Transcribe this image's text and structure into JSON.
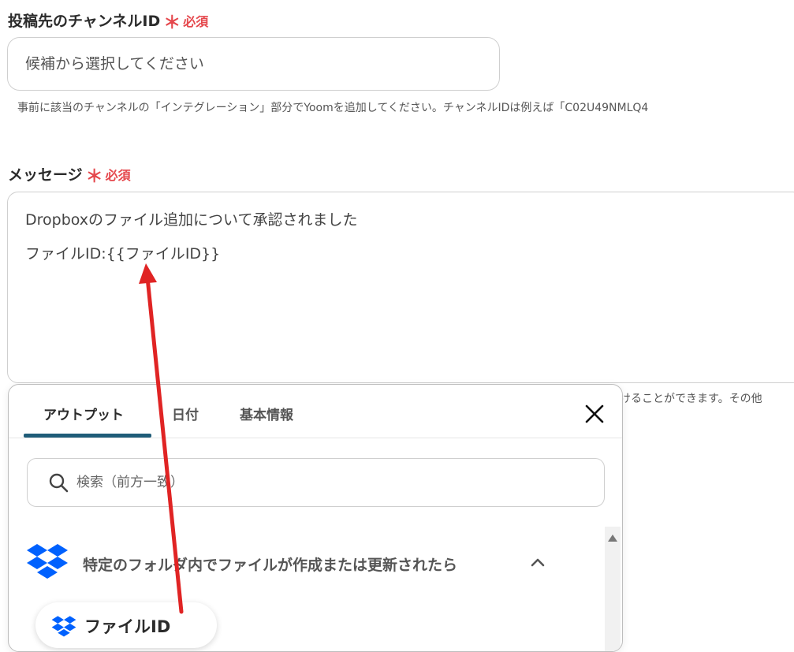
{
  "channel_field": {
    "label": "投稿先のチャンネルID",
    "required_mark": "＊",
    "required_text": "必須",
    "placeholder": "候補から選択してください",
    "hint": "事前に該当のチャンネルの「インテグレーション」部分でYoomを追加してください。チャンネルIDは例えば「C02U49NMLQ4"
  },
  "message_field": {
    "label": "メッセージ",
    "required_mark": "＊",
    "required_text": "必須",
    "lines": [
      "Dropboxのファイル追加について承認されました",
      "ファイルID:{{ファイルID}}"
    ],
    "hint_partial": "けることができます。その他"
  },
  "output_panel": {
    "tabs": [
      {
        "label": "アウトプット",
        "active": true
      },
      {
        "label": "日付",
        "active": false
      },
      {
        "label": "基本情報",
        "active": false
      }
    ],
    "close_icon": "close-icon",
    "search": {
      "placeholder": "検索（前方一致）",
      "icon": "search-icon"
    },
    "group": {
      "title": "特定のフォルダ内でファイルが作成または更新されたら",
      "icon": "dropbox-logo-icon",
      "expanded": true
    },
    "items": [
      {
        "label": "ファイルID",
        "icon": "dropbox-logo-icon"
      }
    ]
  },
  "colors": {
    "required": "#e5484d",
    "tab_underline": "#1f5c78",
    "dropbox_blue": "#0061fe",
    "annotation_arrow": "#e02424"
  }
}
